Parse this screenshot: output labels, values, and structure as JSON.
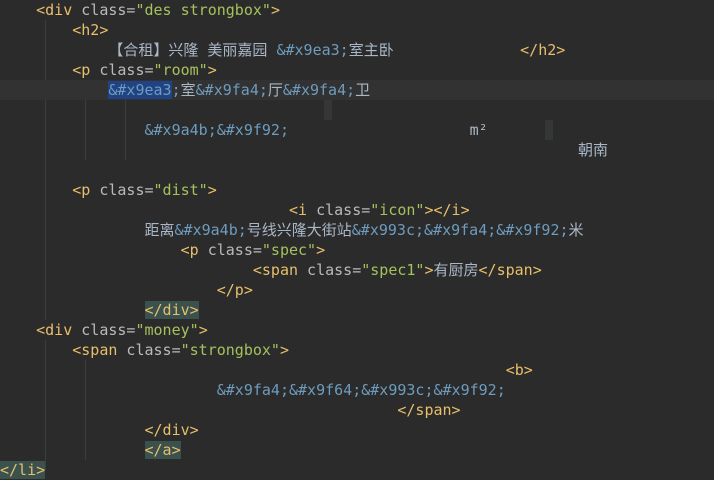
{
  "colors": {
    "background": "#2b2b2b",
    "tag": "#e8bf6a",
    "attribute": "#bababa",
    "attribute_value": "#a5c25c",
    "entity": "#6d9cbe",
    "text": "#a9b7c6",
    "selection": "#214283"
  },
  "lines": [
    {
      "indent": "    ",
      "tokens": [
        {
          "c": "tag",
          "t": "<div"
        },
        {
          "c": "attr",
          "t": " class="
        },
        {
          "c": "val",
          "t": "\"des strongbox\""
        },
        {
          "c": "tag",
          "t": ">"
        }
      ]
    },
    {
      "indent": "        ",
      "tokens": [
        {
          "c": "tag",
          "t": "<h2>"
        }
      ]
    },
    {
      "indent": "            ",
      "tokens": [
        {
          "c": "txt",
          "t": "【合租】兴隆 美丽嘉园 "
        },
        {
          "c": "ent",
          "t": "&#x9ea3;"
        },
        {
          "c": "txt",
          "t": "室主卧              "
        },
        {
          "c": "tag",
          "t": "</h2>"
        }
      ]
    },
    {
      "indent": "        ",
      "tokens": [
        {
          "c": "tag",
          "t": "<p"
        },
        {
          "c": "attr",
          "t": " class="
        },
        {
          "c": "val",
          "t": "\"room\""
        },
        {
          "c": "tag",
          "t": ">"
        }
      ]
    },
    {
      "indent": "            ",
      "current": true,
      "tokens": [
        {
          "c": "sel",
          "t": "&#x9ea3"
        },
        {
          "c": "ent",
          "t": ";"
        },
        {
          "c": "txt",
          "t": "室"
        },
        {
          "c": "ent",
          "t": "&#x9fa4;"
        },
        {
          "c": "txt",
          "t": "厅"
        },
        {
          "c": "ent",
          "t": "&#x9fa4;"
        },
        {
          "c": "txt",
          "t": "卫"
        }
      ]
    },
    {
      "indent": "",
      "tokens": []
    },
    {
      "indent": "                ",
      "tokens": [
        {
          "c": "ent",
          "t": "&#x9a4b;&#x9f92;"
        },
        {
          "c": "txt",
          "t": "                    m²"
        }
      ]
    },
    {
      "indent": "                                                                ",
      "tokens": [
        {
          "c": "txt",
          "t": "朝南"
        }
      ]
    },
    {
      "indent": "",
      "tokens": []
    },
    {
      "indent": "        ",
      "tokens": [
        {
          "c": "tag",
          "t": "<p"
        },
        {
          "c": "attr",
          "t": " class="
        },
        {
          "c": "val",
          "t": "\"dist\""
        },
        {
          "c": "tag",
          "t": ">"
        }
      ]
    },
    {
      "indent": "                                ",
      "tokens": [
        {
          "c": "tag",
          "t": "<i"
        },
        {
          "c": "attr",
          "t": " class="
        },
        {
          "c": "val",
          "t": "\"icon\""
        },
        {
          "c": "tag",
          "t": "></i>"
        }
      ]
    },
    {
      "indent": "                ",
      "tokens": [
        {
          "c": "txt",
          "t": "距离"
        },
        {
          "c": "ent",
          "t": "&#x9a4b;"
        },
        {
          "c": "txt",
          "t": "号线兴隆大街站"
        },
        {
          "c": "ent",
          "t": "&#x993c;&#x9fa4;&#x9f92;"
        },
        {
          "c": "txt",
          "t": "米"
        }
      ]
    },
    {
      "indent": "                    ",
      "tokens": [
        {
          "c": "tag",
          "t": "<p"
        },
        {
          "c": "attr",
          "t": " class="
        },
        {
          "c": "val",
          "t": "\"spec\""
        },
        {
          "c": "tag",
          "t": ">"
        }
      ]
    },
    {
      "indent": "                            ",
      "tokens": [
        {
          "c": "tag",
          "t": "<span"
        },
        {
          "c": "attr",
          "t": " class="
        },
        {
          "c": "val",
          "t": "\"spec1\""
        },
        {
          "c": "tag",
          "t": ">"
        },
        {
          "c": "txt",
          "t": "有厨房"
        },
        {
          "c": "tag",
          "t": "</span>"
        }
      ]
    },
    {
      "indent": "                        ",
      "tokens": [
        {
          "c": "tag",
          "t": "</p>"
        }
      ]
    },
    {
      "indent": "                ",
      "tokens": [
        {
          "c": "tag hl-tag",
          "t": "</div>"
        }
      ]
    },
    {
      "indent": "    ",
      "tokens": [
        {
          "c": "tag",
          "t": "<div"
        },
        {
          "c": "attr",
          "t": " class="
        },
        {
          "c": "val",
          "t": "\"money\""
        },
        {
          "c": "tag",
          "t": ">"
        }
      ]
    },
    {
      "indent": "        ",
      "tokens": [
        {
          "c": "tag",
          "t": "<span"
        },
        {
          "c": "attr",
          "t": " class="
        },
        {
          "c": "val",
          "t": "\"strongbox\""
        },
        {
          "c": "tag",
          "t": ">"
        }
      ]
    },
    {
      "indent": "                                                        ",
      "tokens": [
        {
          "c": "tag",
          "t": "<b>"
        }
      ]
    },
    {
      "indent": "                        ",
      "tokens": [
        {
          "c": "ent",
          "t": "&#x9fa4;&#x9f64;&#x993c;&#x9f92;"
        }
      ]
    },
    {
      "indent": "                                            ",
      "tokens": [
        {
          "c": "tag",
          "t": "</span>"
        }
      ]
    },
    {
      "indent": "                ",
      "tokens": [
        {
          "c": "tag",
          "t": "</div>"
        }
      ]
    },
    {
      "indent": "                ",
      "tokens": [
        {
          "c": "tag hl-tag",
          "t": "</a>"
        }
      ]
    },
    {
      "indent": "",
      "tokens": [
        {
          "c": "tag hl-tag",
          "t": "</li>"
        }
      ]
    }
  ]
}
